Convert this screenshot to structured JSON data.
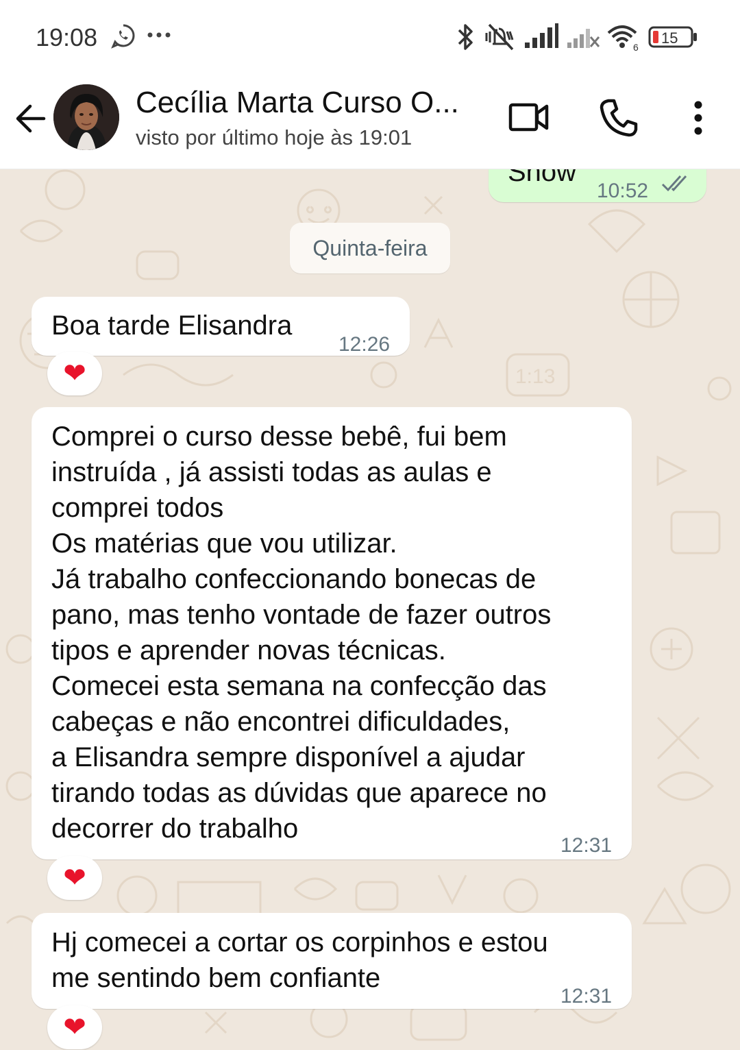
{
  "status_bar": {
    "time": "19:08",
    "battery_level": "15",
    "wifi_badge": "6",
    "icons": [
      "whatsapp-icon",
      "more-dots-icon",
      "bluetooth-icon",
      "vibrate-off-icon",
      "signal-icon",
      "signal-no-service-icon",
      "wifi-icon",
      "battery-icon"
    ]
  },
  "header": {
    "contact_name": "Cecília Marta Curso O...",
    "last_seen": "visto por último hoje às 19:01",
    "icons": [
      "back-arrow-icon",
      "video-call-icon",
      "voice-call-icon",
      "overflow-menu-icon"
    ]
  },
  "chat": {
    "previous_outgoing": {
      "text": "Show",
      "time": "10:52",
      "ticks": "double-check-icon"
    },
    "date_separator": "Quinta-feira",
    "messages": [
      {
        "text": "Boa tarde Elisandra",
        "time": "12:26",
        "reaction": "❤"
      },
      {
        "text": "Comprei o curso desse bebê, fui bem\ninstruída , já assisti todas as aulas e\ncomprei todos\nOs matérias que vou utilizar.\nJá trabalho confeccionando bonecas de\npano, mas tenho vontade de fazer outros\ntipos e aprender novas técnicas.\nComecei esta semana na confecção das\ncabeças e não encontrei dificuldades,\na Elisandra sempre disponível a ajudar\ntirando todas as dúvidas que aparece no\ndecorrer do trabalho",
        "time": "12:31",
        "reaction": "❤"
      },
      {
        "text": "Hj comecei a cortar os corpinhos e estou\nme sentindo  bem confiante",
        "time": "12:31",
        "reaction": "❤"
      }
    ]
  },
  "colors": {
    "wallpaper": "#efe7dd",
    "outgoing_bubble": "#d9fdd3",
    "incoming_bubble": "#ffffff",
    "timestamp": "#667781",
    "read_ticks": "#667781",
    "heart": "#e8132b",
    "battery_low": "#e53935"
  }
}
